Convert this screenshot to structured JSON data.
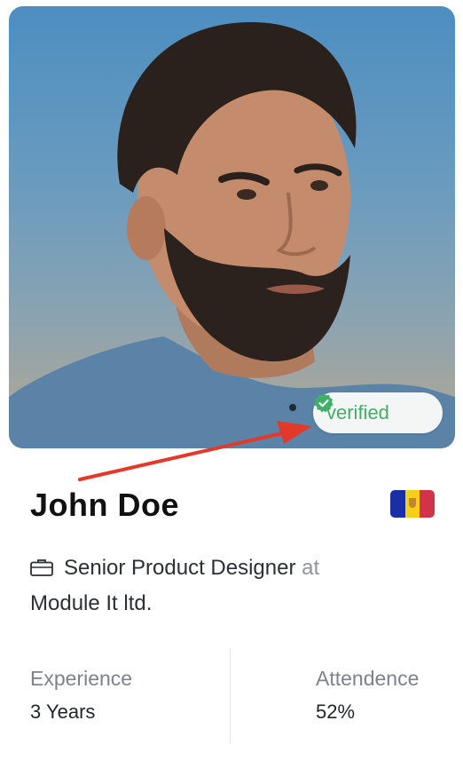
{
  "profile": {
    "badge_label": "verified",
    "name": "John Doe",
    "role": "Senior Product Designer",
    "connector": "at",
    "company": "Module It ltd."
  },
  "stats": [
    {
      "label": "Experience",
      "value": "3 Years"
    },
    {
      "label": "Attendence",
      "value": "52%"
    }
  ],
  "icons": {
    "badge": "verified-check-icon",
    "role": "briefcase-icon",
    "country": "andorra-flag-icon"
  },
  "colors": {
    "verified_green": "#3faf6a",
    "annotation_arrow": "#e3392b",
    "flag_blue": "#1a2fa6",
    "flag_yellow": "#f7cf1a",
    "flag_red": "#d2334a"
  }
}
